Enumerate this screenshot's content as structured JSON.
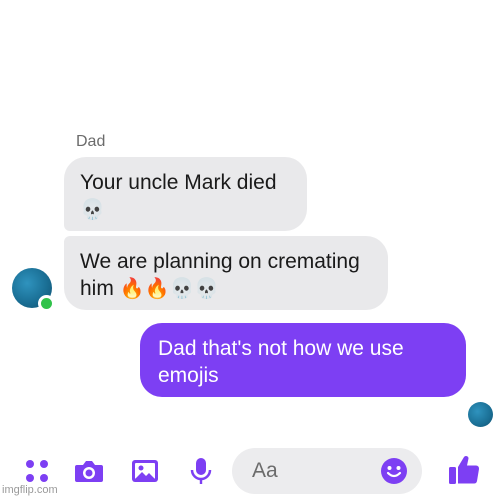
{
  "conversation": {
    "sender_name": "Dad",
    "messages": [
      {
        "direction": "incoming",
        "text": "Your uncle Mark died",
        "emoji": "💀"
      },
      {
        "direction": "incoming",
        "text": "We are planning on cremating him",
        "emoji": "🔥🔥💀💀"
      },
      {
        "direction": "outgoing",
        "text": "Dad that's not how we use emojis"
      }
    ]
  },
  "composer": {
    "placeholder": "Aa",
    "icons": [
      "apps-grid-icon",
      "camera-icon",
      "gallery-icon",
      "microphone-icon",
      "emoji-icon",
      "thumbs-up-icon"
    ]
  },
  "watermark": "imgflip.com",
  "colors": {
    "accent": "#7d3ff3",
    "incoming_bubble": "#e9e9eb",
    "outgoing_bubble": "#7d3ff3",
    "online": "#31c24a"
  }
}
